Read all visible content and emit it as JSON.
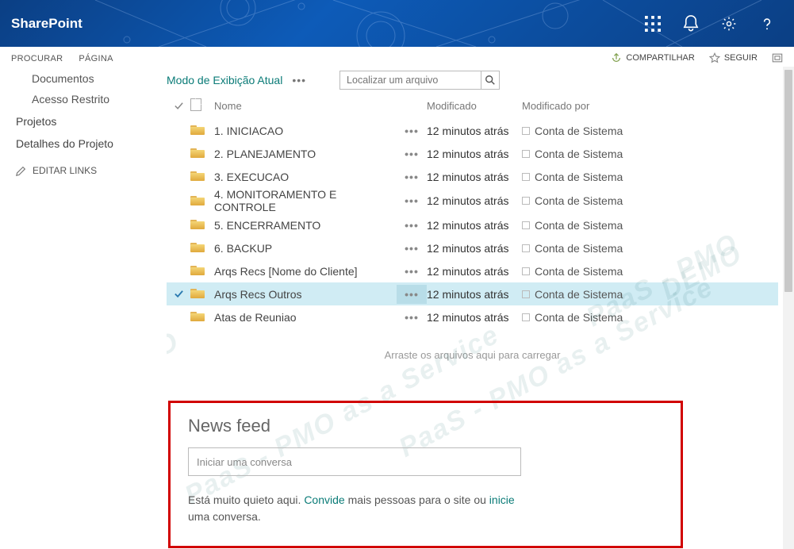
{
  "suite": {
    "brand": "SharePoint"
  },
  "ribbon": {
    "tabs": [
      "PROCURAR",
      "PÁGINA"
    ],
    "share": "COMPARTILHAR",
    "follow": "SEGUIR"
  },
  "sidebar": {
    "items": [
      {
        "label": "Documentos",
        "indent": true
      },
      {
        "label": "Acesso Restrito",
        "indent": true
      },
      {
        "label": "Projetos",
        "indent": false
      },
      {
        "label": "Detalhes do Projeto",
        "indent": false
      }
    ],
    "editLinks": "EDITAR LINKS"
  },
  "toolbar": {
    "viewLabel": "Modo de Exibição Atual",
    "searchPlaceholder": "Localizar um arquivo"
  },
  "table": {
    "headers": {
      "name": "Nome",
      "modified": "Modificado",
      "modifiedBy": "Modificado por"
    },
    "rows": [
      {
        "name": "1. INICIACAO",
        "modified": "12 minutos atrás",
        "by": "Conta de Sistema",
        "selected": false,
        "checked": false
      },
      {
        "name": "2. PLANEJAMENTO",
        "modified": "12 minutos atrás",
        "by": "Conta de Sistema",
        "selected": false,
        "checked": false
      },
      {
        "name": "3. EXECUCAO",
        "modified": "12 minutos atrás",
        "by": "Conta de Sistema",
        "selected": false,
        "checked": false
      },
      {
        "name": "4. MONITORAMENTO E CONTROLE",
        "modified": "12 minutos atrás",
        "by": "Conta de Sistema",
        "selected": false,
        "checked": false
      },
      {
        "name": "5. ENCERRAMENTO",
        "modified": "12 minutos atrás",
        "by": "Conta de Sistema",
        "selected": false,
        "checked": false
      },
      {
        "name": "6. BACKUP",
        "modified": "12 minutos atrás",
        "by": "Conta de Sistema",
        "selected": false,
        "checked": false
      },
      {
        "name": "Arqs Recs [Nome do Cliente]",
        "modified": "12 minutos atrás",
        "by": "Conta de Sistema",
        "selected": false,
        "checked": false
      },
      {
        "name": "Arqs Recs Outros",
        "modified": "12 minutos atrás",
        "by": "Conta de Sistema",
        "selected": true,
        "checked": true
      },
      {
        "name": "Atas de Reuniao",
        "modified": "12 minutos atrás",
        "by": "Conta de Sistema",
        "selected": false,
        "checked": false
      }
    ],
    "dragHint": "Arraste os arquivos aqui para carregar"
  },
  "newsfeed": {
    "title": "News feed",
    "placeholder": "Iniciar uma conversa",
    "msgPre": "Está muito quieto aqui. ",
    "invite": "Convide",
    "msgMid": " mais pessoas para o site ou ",
    "start": "inicie",
    "msgPost": " uma conversa."
  },
  "watermarks": [
    "DEMO",
    "PaaS - PMO as a Service",
    "PaaS - PMO as a Service",
    "PaaS - PMO",
    "DEMO"
  ]
}
